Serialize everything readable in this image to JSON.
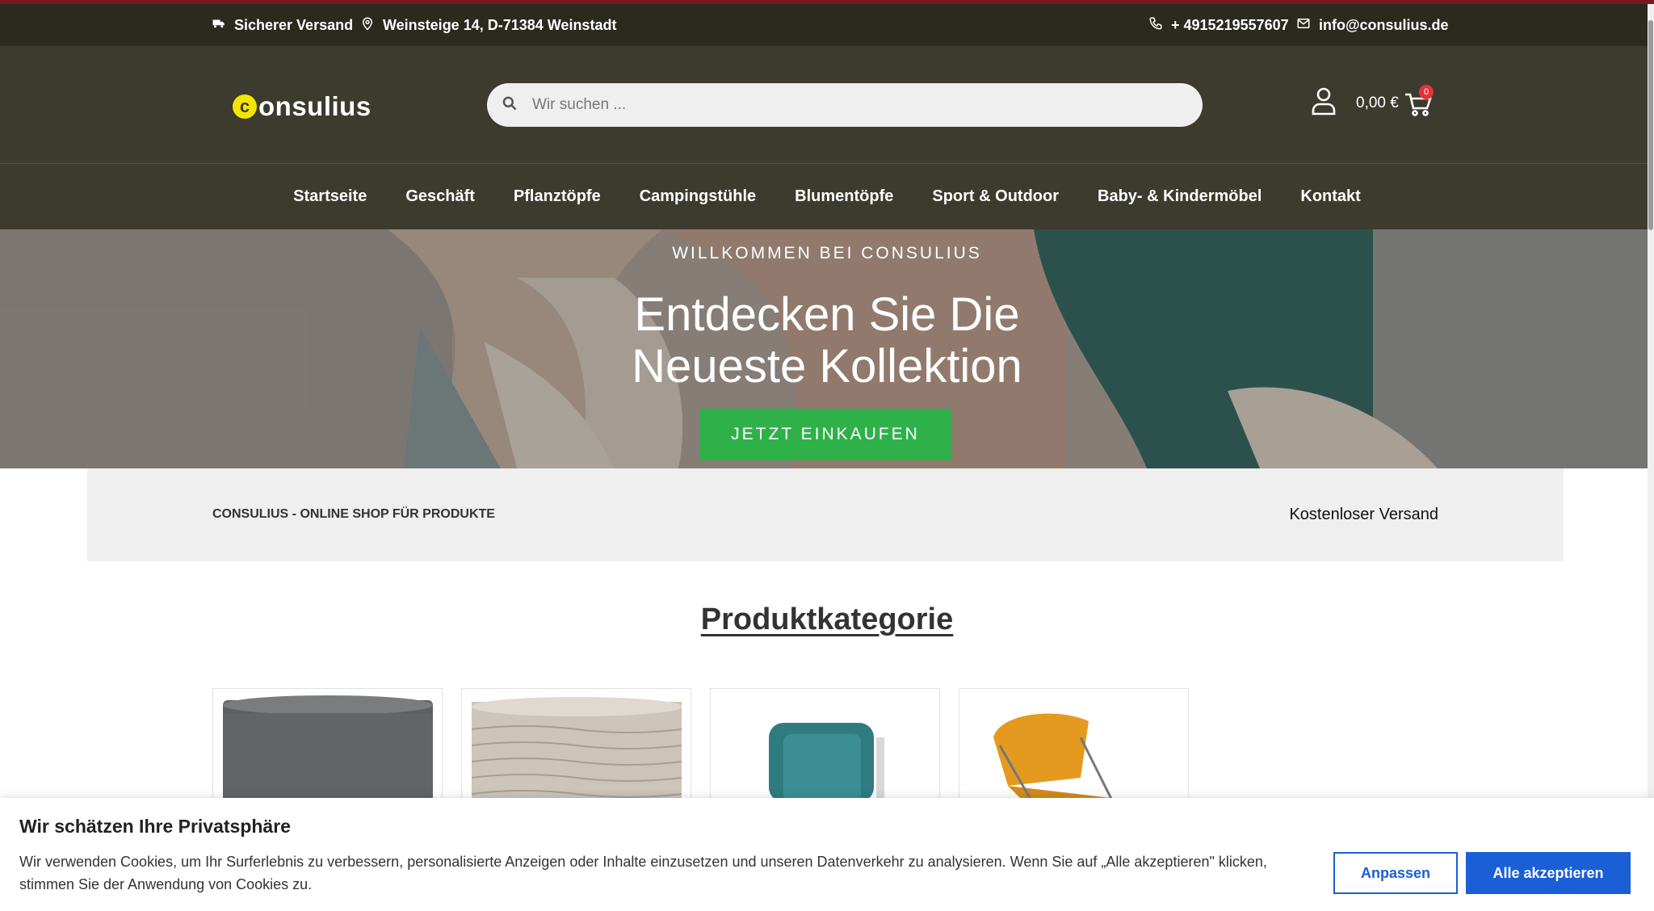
{
  "topbar": {
    "shipping": "Sicherer Versand",
    "address": "Weinsteige 14, D-71384 Weinstadt",
    "phone": "+ 4915219557607",
    "email": "info@consulius.de"
  },
  "header": {
    "logo_letter": "c",
    "logo_text": "onsulius",
    "search_placeholder": "Wir suchen ...",
    "cart_total": "0,00 €",
    "cart_count": "0"
  },
  "nav": {
    "items": [
      "Startseite",
      "Geschäft",
      "Pflanztöpfe",
      "Campingstühle",
      "Blumentöpfe",
      "Sport & Outdoor",
      "Baby- & Kindermöbel",
      "Kontakt"
    ]
  },
  "hero": {
    "kicker": "WILLKOMMEN BEI CONSULIUS",
    "headline_line1": "Entdecken Sie Die",
    "headline_line2": "Neueste Kollektion",
    "cta": "JETZT EINKAUFEN"
  },
  "info_band": {
    "left": "CONSULIUS - ONLINE SHOP FÜR PRODUKTE",
    "right": "Kostenloser Versand"
  },
  "category": {
    "title": "Produktkategorie"
  },
  "cookie": {
    "title": "Wir schätzen Ihre Privatsphäre",
    "text": "Wir verwenden Cookies, um Ihr Surferlebnis zu verbessern, personalisierte Anzeigen oder Inhalte einzusetzen und unseren Datenverkehr zu analysieren. Wenn Sie auf „Alle akzeptieren\" klicken, stimmen Sie der Anwendung von Cookies zu.",
    "customize": "Anpassen",
    "accept_all": "Alle akzeptieren"
  },
  "colors": {
    "header_bg": "#3d3a2e",
    "topbar_bg": "#2b2a1f",
    "cta_green": "#2fb14a",
    "cookie_blue": "#1a5fd6",
    "badge_red": "#e2343a",
    "logo_yellow": "#f2e600"
  }
}
